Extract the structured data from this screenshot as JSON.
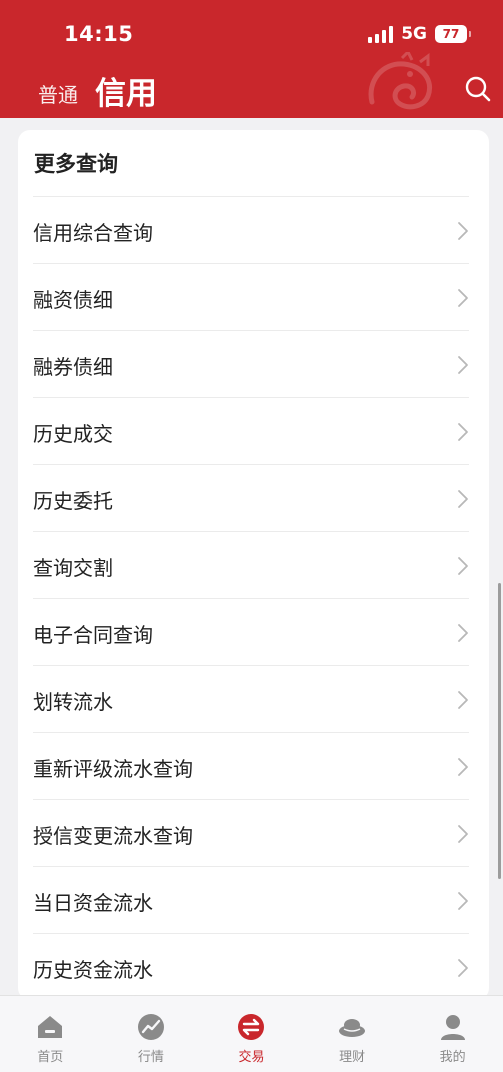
{
  "status_bar": {
    "time": "14:15",
    "network": "5G",
    "battery": "77"
  },
  "header": {
    "tab_normal": "普通",
    "tab_credit": "信用"
  },
  "card": {
    "title": "更多查询",
    "items": [
      {
        "label": "信用综合查询"
      },
      {
        "label": "融资债细"
      },
      {
        "label": "融券债细"
      },
      {
        "label": "历史成交"
      },
      {
        "label": "历史委托"
      },
      {
        "label": "查询交割"
      },
      {
        "label": "电子合同查询"
      },
      {
        "label": "划转流水"
      },
      {
        "label": "重新评级流水查询"
      },
      {
        "label": "授信变更流水查询"
      },
      {
        "label": "当日资金流水"
      },
      {
        "label": "历史资金流水"
      }
    ]
  },
  "bottom_nav": {
    "items": [
      {
        "label": "首页",
        "icon": "home-icon"
      },
      {
        "label": "行情",
        "icon": "market-icon"
      },
      {
        "label": "交易",
        "icon": "trade-icon",
        "active": true
      },
      {
        "label": "理财",
        "icon": "wealth-icon"
      },
      {
        "label": "我的",
        "icon": "profile-icon"
      }
    ]
  },
  "colors": {
    "brand_red": "#c9272c",
    "background": "#f1f1f3",
    "inactive_gray": "#8a8a8a"
  }
}
